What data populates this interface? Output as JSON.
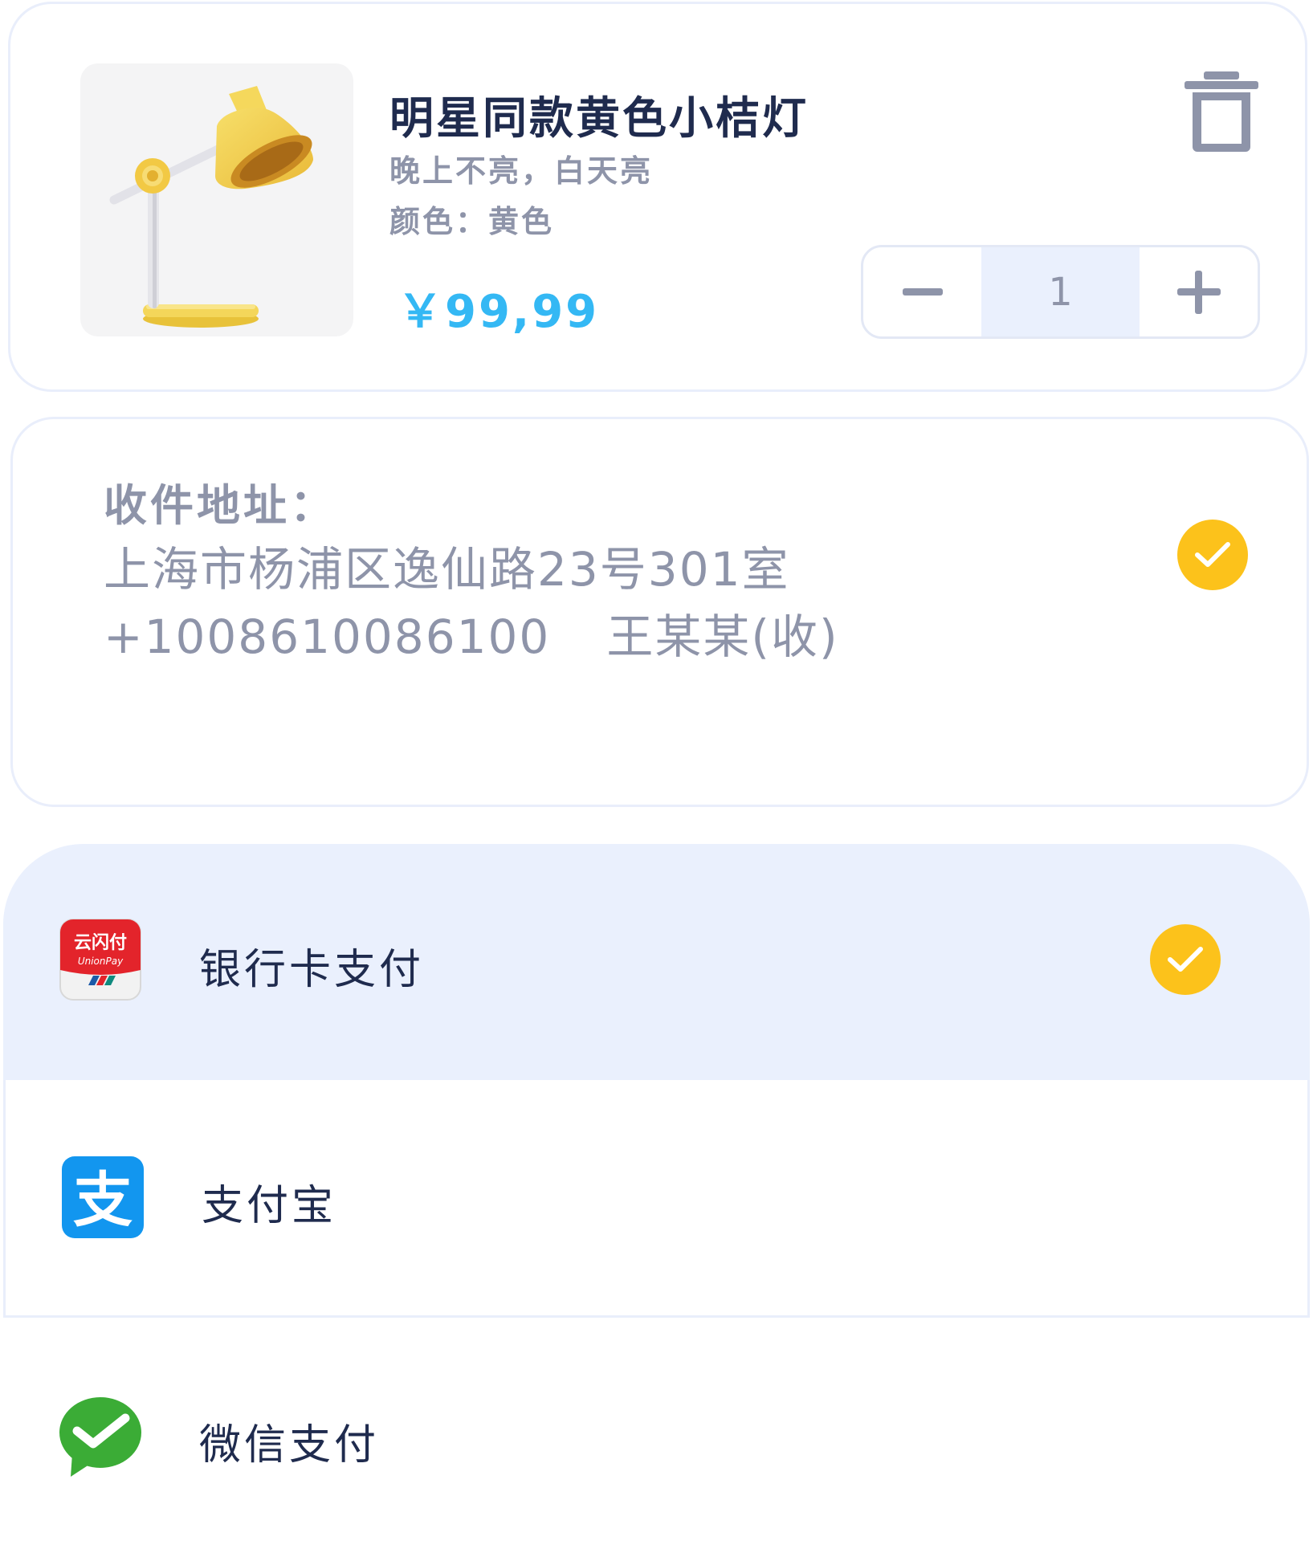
{
  "product": {
    "title": "明星同款黄色小桔灯",
    "description": "晚上不亮，白天亮",
    "color": "颜色：黄色",
    "price": "￥99,99",
    "quantity": "1",
    "image_name": "yellow-desk-lamp"
  },
  "address": {
    "label": "收件地址：",
    "line": "上海市杨浦区逸仙路23号301室",
    "phone": "+1008610086100",
    "recipient": "王某某(收)",
    "selected": true
  },
  "payment": {
    "options": [
      {
        "label": "银行卡支付",
        "icon": "unionpay-icon",
        "icon_title": "云闪付",
        "icon_subtitle": "UnionPay",
        "selected": true
      },
      {
        "label": "支付宝",
        "icon": "alipay-icon",
        "icon_glyph": "支",
        "selected": false
      },
      {
        "label": "微信支付",
        "icon": "wechat-pay-icon",
        "selected": false
      }
    ]
  },
  "colors": {
    "accent_check": "#fcc21b",
    "price": "#34b8f4",
    "title": "#1f2b4e",
    "muted": "#8e94a9",
    "selected_bg": "#eaf0fd",
    "unionpay_red": "#e3242b",
    "alipay_blue": "#1296ef",
    "wechat_green": "#3bac36"
  }
}
